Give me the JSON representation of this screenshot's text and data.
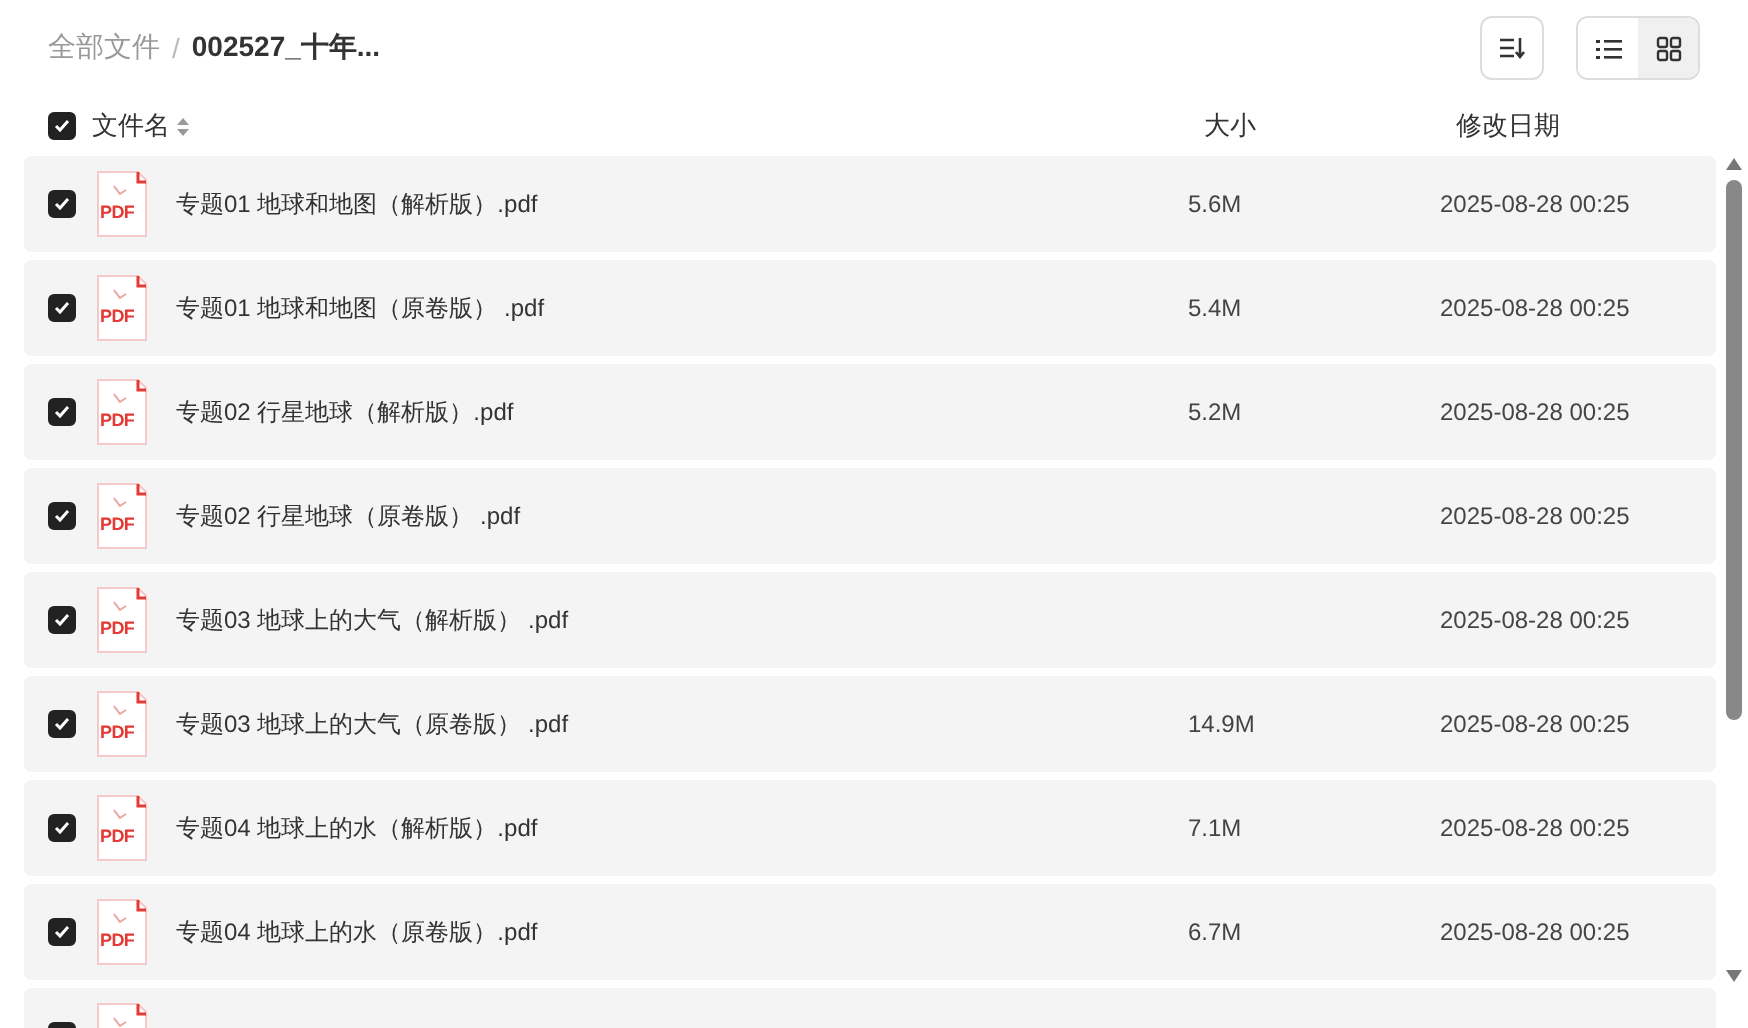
{
  "breadcrumb": [
    {
      "label": "全部文件",
      "current": false
    },
    {
      "separator": "/",
      "label": "002527_十年...",
      "current": true
    }
  ],
  "view_toggle": [
    {
      "kind": "list",
      "selected": true
    },
    {
      "kind": "grid",
      "selected": false
    }
  ],
  "table": {
    "select_all": {
      "checked": true
    },
    "columns": [
      "文件名",
      "大小",
      "修改日期"
    ],
    "rows": [
      {
        "checked": true,
        "file_type": "PDF",
        "name": "专题01 地球和地图（解析版）.pdf",
        "size": "5.6M",
        "modified": "2025-08-28 00:25"
      },
      {
        "checked": true,
        "file_type": "PDF",
        "name": "专题01 地球和地图（原卷版） .pdf",
        "size": "5.4M",
        "modified": "2025-08-28 00:25"
      },
      {
        "checked": true,
        "file_type": "PDF",
        "name": "专题02 行星地球（解析版）.pdf",
        "size": "5.2M",
        "modified": "2025-08-28 00:25"
      },
      {
        "checked": true,
        "file_type": "PDF",
        "name": "专题02 行星地球（原卷版） .pdf",
        "modified": "2025-08-28 00:25"
      },
      {
        "checked": true,
        "file_type": "PDF",
        "name": "专题03 地球上的大气（解析版） .pdf",
        "modified": "2025-08-28 00:25"
      },
      {
        "checked": true,
        "file_type": "PDF",
        "name": "专题03 地球上的大气（原卷版） .pdf",
        "size": "14.9M",
        "modified": "2025-08-28 00:25"
      },
      {
        "checked": true,
        "file_type": "PDF",
        "name": "专题04 地球上的水（解析版）.pdf",
        "size": "7.1M",
        "modified": "2025-08-28 00:25"
      },
      {
        "checked": true,
        "file_type": "PDF",
        "name": "专题04 地球上的水（原卷版）.pdf",
        "size": "6.7M",
        "modified": "2025-08-28 00:25"
      },
      {
        "checked": true
      }
    ]
  }
}
